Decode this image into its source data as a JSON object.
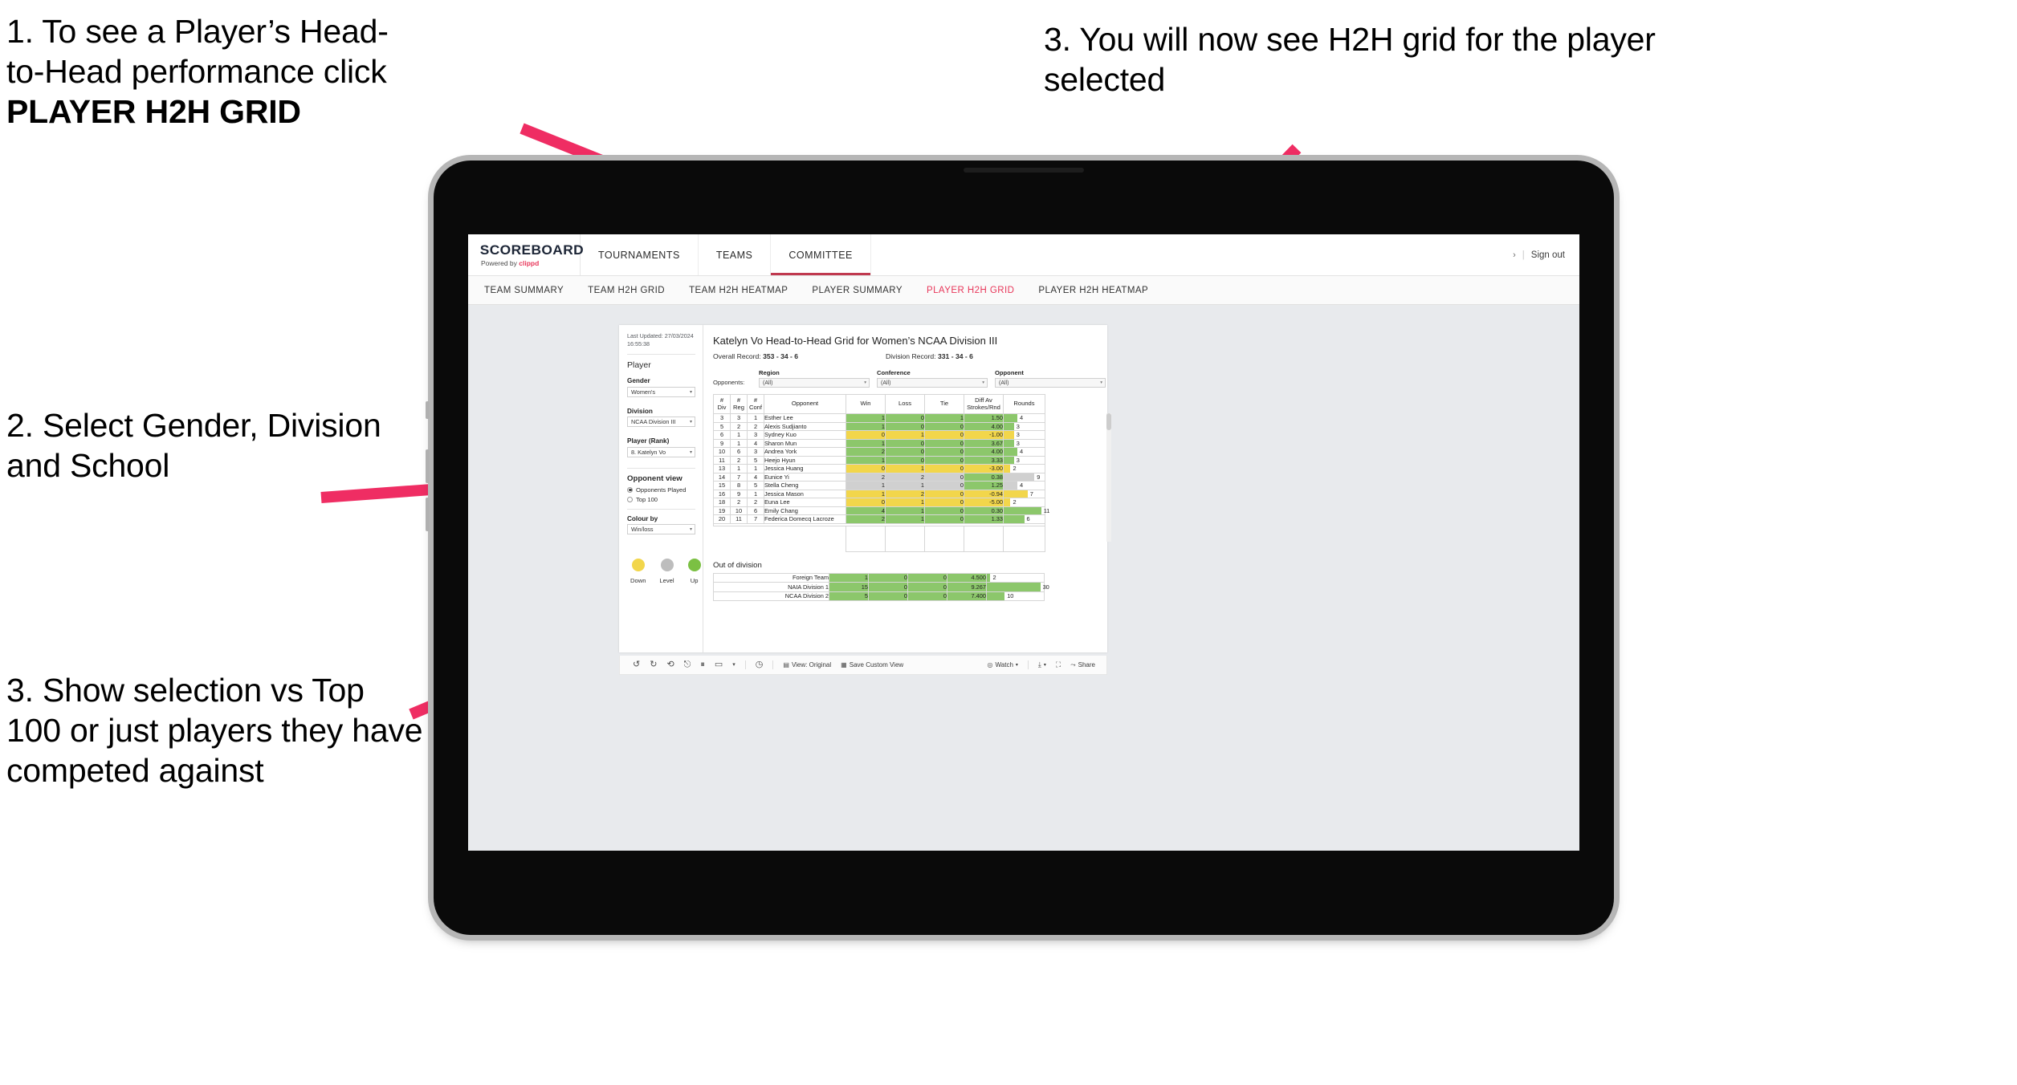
{
  "annotations": [
    {
      "id": "a1",
      "line1": "1. To see a Player’s Head-",
      "line2": "to-Head performance click",
      "line3": "PLAYER H2H GRID"
    },
    {
      "id": "a2",
      "text": "2. Select Gender, Division and School"
    },
    {
      "id": "a3",
      "text": "3. Show selection vs Top 100 or just players they have competed against"
    },
    {
      "id": "a4",
      "text": "3. You will now see H2H grid for the player selected"
    }
  ],
  "app": {
    "brand": {
      "title": "SCOREBOARD",
      "powered_prefix": "Powered by ",
      "powered_name": "clippd"
    },
    "topnav": [
      {
        "label": "TOURNAMENTS",
        "active": false
      },
      {
        "label": "TEAMS",
        "active": false
      },
      {
        "label": "COMMITTEE",
        "active": true
      }
    ],
    "account": {
      "chevron": "›",
      "separator": "|",
      "sign_out": "Sign out"
    },
    "subnav": [
      {
        "label": "TEAM SUMMARY",
        "active": false
      },
      {
        "label": "TEAM H2H GRID",
        "active": false
      },
      {
        "label": "TEAM H2H HEATMAP",
        "active": false
      },
      {
        "label": "PLAYER SUMMARY",
        "active": false
      },
      {
        "label": "PLAYER H2H GRID",
        "active": true
      },
      {
        "label": "PLAYER H2H HEATMAP",
        "active": false
      }
    ]
  },
  "filters": {
    "last_updated_line1": "Last Updated: 27/03/2024",
    "last_updated_line2": "16:55:38",
    "section_player": "Player",
    "gender_label": "Gender",
    "gender_value": "Women's",
    "division_label": "Division",
    "division_value": "NCAA Division III",
    "player_label": "Player (Rank)",
    "player_value": "8. Katelyn Vo",
    "opponent_view_label": "Opponent view",
    "opponent_view_options": [
      {
        "label": "Opponents Played",
        "selected": true
      },
      {
        "label": "Top 100",
        "selected": false
      }
    ],
    "colour_by_label": "Colour by",
    "colour_by_value": "Win/loss",
    "legend": [
      {
        "label": "Down",
        "color": "#F2D64B"
      },
      {
        "label": "Level",
        "color": "#BDBDBD"
      },
      {
        "label": "Up",
        "color": "#7BC043"
      }
    ]
  },
  "viz": {
    "title": "Katelyn Vo Head-to-Head Grid for Women’s NCAA Division III",
    "overall_record_label": "Overall Record:",
    "overall_record_value": "353 - 34 - 6",
    "division_record_label": "Division Record:",
    "division_record_value": "331 - 34 - 6",
    "opponents_label": "Opponents:",
    "opponent_filters": [
      {
        "caption": "Region",
        "value": "(All)"
      },
      {
        "caption": "Conference",
        "value": "(All)"
      },
      {
        "caption": "Opponent",
        "value": "(All)"
      }
    ]
  },
  "chart_data": {
    "type": "table",
    "title": "Katelyn Vo Head-to-Head Grid for Women’s NCAA Division III",
    "columns": [
      "# Div",
      "# Reg",
      "# Conf",
      "Opponent",
      "Win",
      "Loss",
      "Tie",
      "Diff Av Strokes/Rnd",
      "Rounds"
    ],
    "column_header_lines": [
      [
        "#",
        "Div"
      ],
      [
        "#",
        "Reg"
      ],
      [
        "#",
        "Conf"
      ],
      [
        "Opponent"
      ],
      [
        "Win"
      ],
      [
        "Loss"
      ],
      [
        "Tie"
      ],
      [
        "Diff Av",
        "Strokes/Rnd"
      ],
      [
        "Rounds"
      ]
    ],
    "colors": {
      "up": "#8CC76B",
      "down": "#F2D64B",
      "level": "#D0D0D0",
      "bar_track": "#FFFFFF"
    },
    "rounds_max": 12,
    "rows": [
      {
        "div": "3",
        "reg": "3",
        "conf": "1",
        "opponent": "Esther Lee",
        "win": "1",
        "loss": "0",
        "tie": "1",
        "diff": "1.50",
        "rounds": "4",
        "state": "up"
      },
      {
        "div": "5",
        "reg": "2",
        "conf": "2",
        "opponent": "Alexis Sudjianto",
        "win": "1",
        "loss": "0",
        "tie": "0",
        "diff": "4.00",
        "rounds": "3",
        "state": "up"
      },
      {
        "div": "6",
        "reg": "1",
        "conf": "3",
        "opponent": "Sydney Kuo",
        "win": "0",
        "loss": "1",
        "tie": "0",
        "diff": "-1.00",
        "rounds": "3",
        "state": "down"
      },
      {
        "div": "9",
        "reg": "1",
        "conf": "4",
        "opponent": "Sharon Mun",
        "win": "1",
        "loss": "0",
        "tie": "0",
        "diff": "3.67",
        "rounds": "3",
        "state": "up"
      },
      {
        "div": "10",
        "reg": "6",
        "conf": "3",
        "opponent": "Andrea York",
        "win": "2",
        "loss": "0",
        "tie": "0",
        "diff": "4.00",
        "rounds": "4",
        "state": "up"
      },
      {
        "div": "11",
        "reg": "2",
        "conf": "5",
        "opponent": "Heejo Hyun",
        "win": "1",
        "loss": "0",
        "tie": "0",
        "diff": "3.33",
        "rounds": "3",
        "state": "up"
      },
      {
        "div": "13",
        "reg": "1",
        "conf": "1",
        "opponent": "Jessica Huang",
        "win": "0",
        "loss": "1",
        "tie": "0",
        "diff": "-3.00",
        "rounds": "2",
        "state": "down"
      },
      {
        "div": "14",
        "reg": "7",
        "conf": "4",
        "opponent": "Eunice Yi",
        "win": "2",
        "loss": "2",
        "tie": "0",
        "diff": "0.38",
        "rounds": "9",
        "state": "level",
        "diff_state": "up"
      },
      {
        "div": "15",
        "reg": "8",
        "conf": "5",
        "opponent": "Stella Cheng",
        "win": "1",
        "loss": "1",
        "tie": "0",
        "diff": "1.25",
        "rounds": "4",
        "state": "level",
        "diff_state": "up"
      },
      {
        "div": "16",
        "reg": "9",
        "conf": "1",
        "opponent": "Jessica Mason",
        "win": "1",
        "loss": "2",
        "tie": "0",
        "diff": "-0.94",
        "rounds": "7",
        "state": "down"
      },
      {
        "div": "18",
        "reg": "2",
        "conf": "2",
        "opponent": "Euna Lee",
        "win": "0",
        "loss": "1",
        "tie": "0",
        "diff": "-5.00",
        "rounds": "2",
        "state": "down"
      },
      {
        "div": "19",
        "reg": "10",
        "conf": "6",
        "opponent": "Emily Chang",
        "win": "4",
        "loss": "1",
        "tie": "0",
        "diff": "0.30",
        "rounds": "11",
        "state": "up"
      },
      {
        "div": "20",
        "reg": "11",
        "conf": "7",
        "opponent": "Federica Domecq Lacroze",
        "win": "2",
        "loss": "1",
        "tie": "0",
        "diff": "1.33",
        "rounds": "6",
        "state": "up"
      }
    ]
  },
  "out_of_division": {
    "heading": "Out of division",
    "rounds_max": 32,
    "rows": [
      {
        "name": "Foreign Team",
        "win": "1",
        "loss": "0",
        "tie": "0",
        "diff": "4.500",
        "rounds": "2",
        "state": "up"
      },
      {
        "name": "NAIA Division 1",
        "win": "15",
        "loss": "0",
        "tie": "0",
        "diff": "9.267",
        "rounds": "30",
        "state": "up"
      },
      {
        "name": "NCAA Division 2",
        "win": "5",
        "loss": "0",
        "tie": "0",
        "diff": "7.400",
        "rounds": "10",
        "state": "up"
      }
    ]
  },
  "toolbar": {
    "view_label": "View: Original",
    "save_label": "Save Custom View",
    "watch_label": "Watch",
    "share_label": "Share"
  }
}
